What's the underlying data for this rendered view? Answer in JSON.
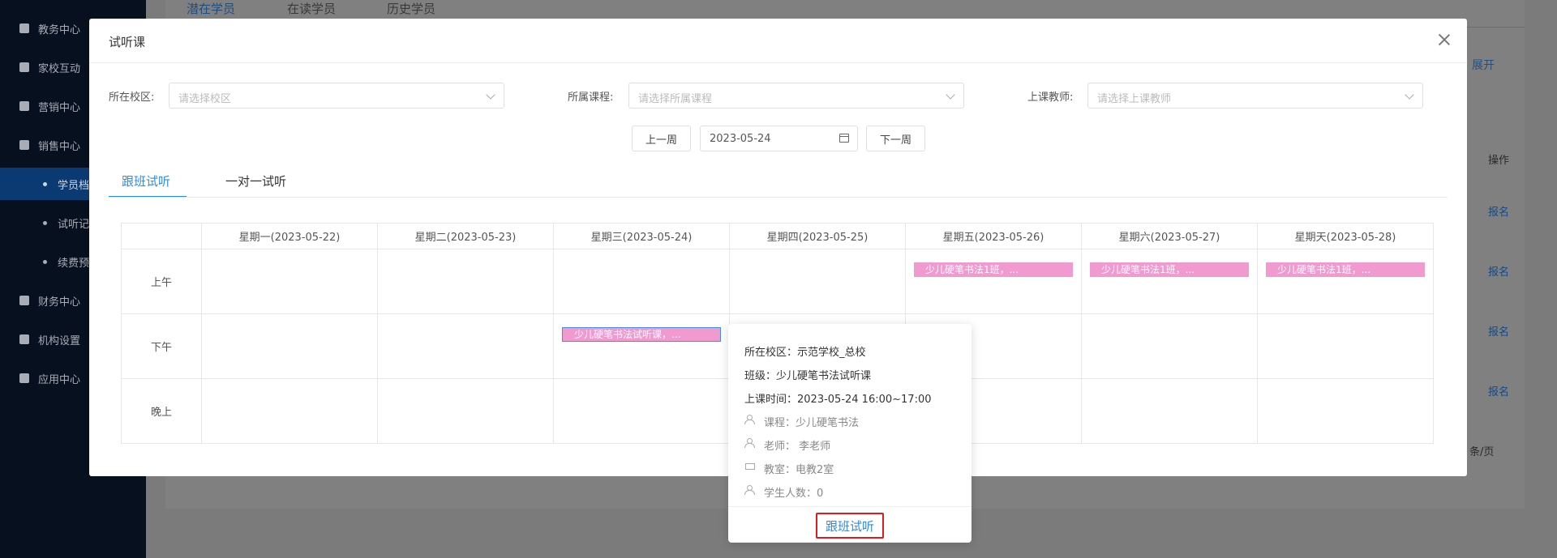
{
  "sidebar": {
    "items": [
      {
        "label": "教务中心",
        "icon": "book-icon"
      },
      {
        "label": "家校互动",
        "icon": "chat-icon"
      },
      {
        "label": "营销中心",
        "icon": "gift-icon"
      },
      {
        "label": "销售中心",
        "icon": "people-icon"
      },
      {
        "label": "财务中心",
        "icon": "wallet-icon"
      },
      {
        "label": "机构设置",
        "icon": "gear-icon"
      },
      {
        "label": "应用中心",
        "icon": "grid-icon"
      }
    ],
    "subitems": [
      {
        "label": "学员档"
      },
      {
        "label": "试听记"
      },
      {
        "label": "续费预"
      }
    ]
  },
  "background": {
    "tabs": [
      "潜在学员",
      "在读学员",
      "历史学员"
    ],
    "expand_label": "展开",
    "operation_header": "操作",
    "row_links": [
      "报名",
      "报名",
      "报名",
      "报名"
    ],
    "pagesize_label": "条/页"
  },
  "modal": {
    "title": "试听课",
    "filters": {
      "campus_label": "所在校区:",
      "campus_placeholder": "请选择校区",
      "course_label": "所属课程:",
      "course_placeholder": "请选择所属课程",
      "teacher_label": "上课教师:",
      "teacher_placeholder": "请选择上课教师"
    },
    "nav": {
      "prev_week": "上一周",
      "date": "2023-05-24",
      "next_week": "下一周"
    },
    "tabs": [
      "跟班试听",
      "一对一试听"
    ],
    "days": [
      "星期一(2023-05-22)",
      "星期二(2023-05-23)",
      "星期三(2023-05-24)",
      "星期四(2023-05-25)",
      "星期五(2023-05-26)",
      "星期六(2023-05-27)",
      "星期天(2023-05-28)"
    ],
    "periods": [
      "上午",
      "下午",
      "晚上"
    ],
    "events": {
      "fri_am": "少儿硬笔书法1班，...",
      "sat_am": "少儿硬笔书法1班，...",
      "sun_am": "少儿硬笔书法1班，...",
      "wed_pm": "少儿硬笔书法试听课，..."
    }
  },
  "popover": {
    "campus": "所在校区：示范学校_总校",
    "class": "班级：少儿硬笔书法试听课",
    "time": "上课时间：2023-05-24 16:00~17:00",
    "course": "课程：少儿硬笔书法",
    "teacher": "老师： 李老师",
    "room": "教室：电教2室",
    "students": "学生人数：0",
    "action": "跟班试听"
  }
}
